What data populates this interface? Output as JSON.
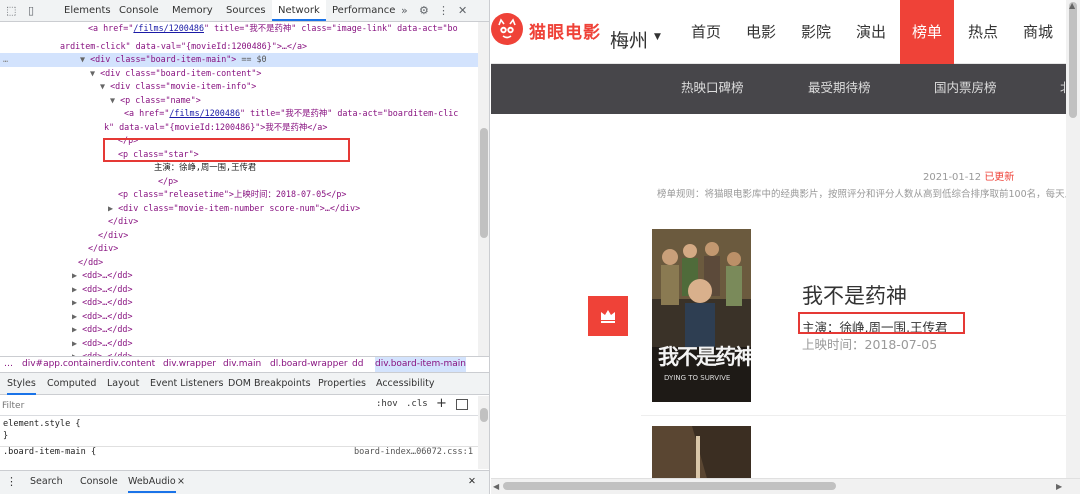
{
  "devtools": {
    "tabs": [
      "Elements",
      "Console",
      "Memory",
      "Sources",
      "Network",
      "Performance"
    ],
    "active_tab": "Network",
    "code_lines": [
      {
        "prefix": "<a href=\"",
        "link": "/films/1200486",
        "rest": "\" title=\"我不是药神\" class=\"image-link\" data-act=\"bo"
      },
      {
        "text": "arditem-click\" data-val=\"{movieId:1200486}\">…</a>"
      },
      {
        "arrow": "▼",
        "open": "<div class=\"board-item-main\">",
        "sel": " == $0"
      },
      {
        "arrow": "▼",
        "open": "<div class=\"board-item-content\">"
      },
      {
        "arrow": "▼",
        "open": "<div class=\"movie-item-info\">"
      },
      {
        "arrow": "▼",
        "open": "<p class=\"name\">"
      },
      {
        "prefix": "<a href=\"",
        "link": "/films/1200486",
        "rest": "\" title=\"我不是药神\" data-act=\"boarditem-clic"
      },
      {
        "text": "k\" data-val=\"{movieId:1200486}\">我不是药神</a>"
      },
      {
        "text": "</p>"
      },
      {
        "text": "<p class=\"star\">"
      },
      {
        "text": "主演：徐峥,周一围,王传君"
      },
      {
        "text": "</p>"
      },
      {
        "text": "<p class=\"releasetime\">上映时间：2018-07-05</p>"
      },
      {
        "arrow": "▶",
        "text": "<div class=\"movie-item-number score-num\">…</div>"
      },
      {
        "text": "</div>"
      },
      {
        "text": "</div>"
      },
      {
        "text": "</div>"
      },
      {
        "text": "</dd>"
      },
      {
        "arrow": "▶",
        "text": "<dd>…</dd>"
      },
      {
        "arrow": "▶",
        "text": "<dd>…</dd>"
      },
      {
        "arrow": "▶",
        "text": "<dd>…</dd>"
      },
      {
        "arrow": "▶",
        "text": "<dd>…</dd>"
      },
      {
        "arrow": "▶",
        "text": "<dd>…</dd>"
      },
      {
        "arrow": "▶",
        "text": "<dd>…</dd>"
      },
      {
        "arrow": "▶",
        "text": "<dd>…</dd>"
      },
      {
        "arrow": "▶",
        "text": "<dd>…</dd>"
      }
    ],
    "breadcrumbs": [
      "…",
      "div#app.container",
      "div.content",
      "div.wrapper",
      "div.main",
      "dl.board-wrapper",
      "dd",
      "div.board-item-main"
    ],
    "panel_tabs": [
      "Styles",
      "Computed",
      "Layout",
      "Event Listeners",
      "DOM Breakpoints",
      "Properties",
      "Accessibility"
    ],
    "filter_placeholder": "Filter",
    "hov": ":hov",
    "cls": ".cls",
    "plus": "+",
    "styles": {
      "element_style": "element.style {",
      "close": "}",
      "rule_selector": ".board-item-main {",
      "rule_source": "board-index…06072.css:1"
    },
    "drawer_tabs": [
      "Search",
      "Console",
      "WebAudio"
    ],
    "drawer_close": "×"
  },
  "page": {
    "logo_text": "猫眼电影",
    "city": "梅州",
    "nav": [
      "首页",
      "电影",
      "影院",
      "演出",
      "榜单",
      "热点",
      "商城"
    ],
    "active_nav": "榜单",
    "subnav": [
      "热映口碑榜",
      "最受期待榜",
      "国内票房榜",
      "北"
    ],
    "date": "2021-01-12",
    "updated": "已更新",
    "rule": "榜单规则：将猫眼电影库中的经典影片，按照评分和评分人数从高到低综合排序取前100名，每天上",
    "movie": {
      "title": "我不是药神",
      "star": "主演：徐峥,周一围,王传君",
      "release": "上映时间：2018-07-05",
      "poster_text": "我不是药神",
      "poster_subtitle": "DYING TO SURVIVE"
    }
  },
  "colors": {
    "brand": "#ef4238",
    "subnav_bg": "#47464a",
    "highlight_box": "#e53935"
  }
}
